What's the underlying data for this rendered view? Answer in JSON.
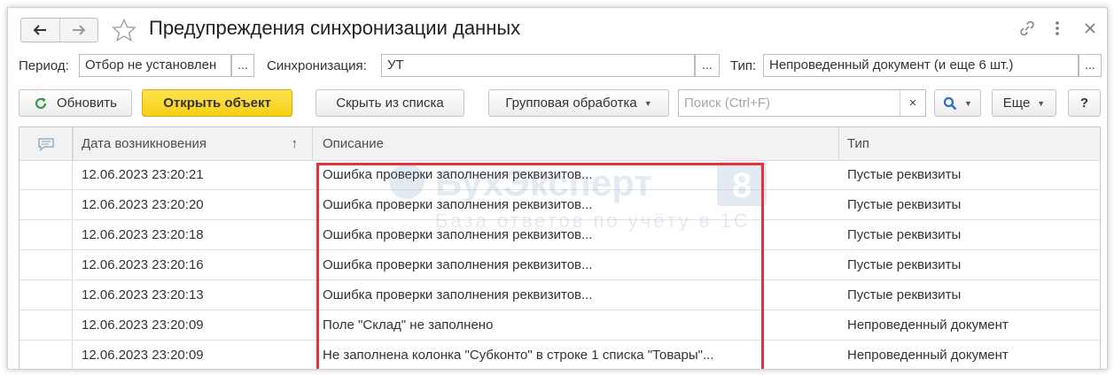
{
  "window": {
    "title": "Предупреждения синхронизации данных",
    "back_icon": "arrow-left-icon",
    "forward_icon": "arrow-right-icon",
    "favorite_icon": "star-icon",
    "link_icon": "link-icon",
    "more_icon": "vertical-dots-icon",
    "close_icon": "close-icon"
  },
  "filters": {
    "period_label": "Период:",
    "period_value": "Отбор не установлен",
    "sync_label": "Синхронизация:",
    "sync_value": "УТ",
    "type_label": "Тип:",
    "type_value": "Непроведенный документ (и еще 6 шт.)",
    "select_label": "..."
  },
  "toolbar": {
    "refresh_label": "Обновить",
    "open_label": "Открыть объект",
    "hide_label": "Скрыть из списка",
    "group_label": "Групповая обработка",
    "search_placeholder": "Поиск (Ctrl+F)",
    "clear_label": "×",
    "more_label": "Еще",
    "help_label": "?"
  },
  "table": {
    "columns": {
      "date": "Дата возникновения",
      "sort_indicator": "↑",
      "description": "Описание",
      "type": "Тип"
    },
    "rows": [
      {
        "date": "12.06.2023 23:20:21",
        "description": "Ошибка проверки заполнения реквизитов...",
        "type": "Пустые реквизиты"
      },
      {
        "date": "12.06.2023 23:20:20",
        "description": "Ошибка проверки заполнения реквизитов...",
        "type": "Пустые реквизиты"
      },
      {
        "date": "12.06.2023 23:20:18",
        "description": "Ошибка проверки заполнения реквизитов...",
        "type": "Пустые реквизиты"
      },
      {
        "date": "12.06.2023 23:20:16",
        "description": "Ошибка проверки заполнения реквизитов...",
        "type": "Пустые реквизиты"
      },
      {
        "date": "12.06.2023 23:20:13",
        "description": "Ошибка проверки заполнения реквизитов...",
        "type": "Пустые реквизиты"
      },
      {
        "date": "12.06.2023 23:20:09",
        "description": "Поле \"Склад\" не заполнено",
        "type": "Непроведенный документ"
      },
      {
        "date": "12.06.2023 23:20:09",
        "description": "Не заполнена колонка \"Субконто\" в строке 1 списка \"Товары\"...",
        "type": "Непроведенный документ"
      }
    ]
  },
  "watermark": {
    "brand": "БухЭксперт",
    "digit": "8",
    "tagline": "База ответов по учёту в 1С"
  },
  "colors": {
    "accent_yellow": "#f5cf15",
    "highlight_red": "#e4343b",
    "refresh_green": "#2f9e44",
    "search_blue": "#2f6fc9"
  }
}
